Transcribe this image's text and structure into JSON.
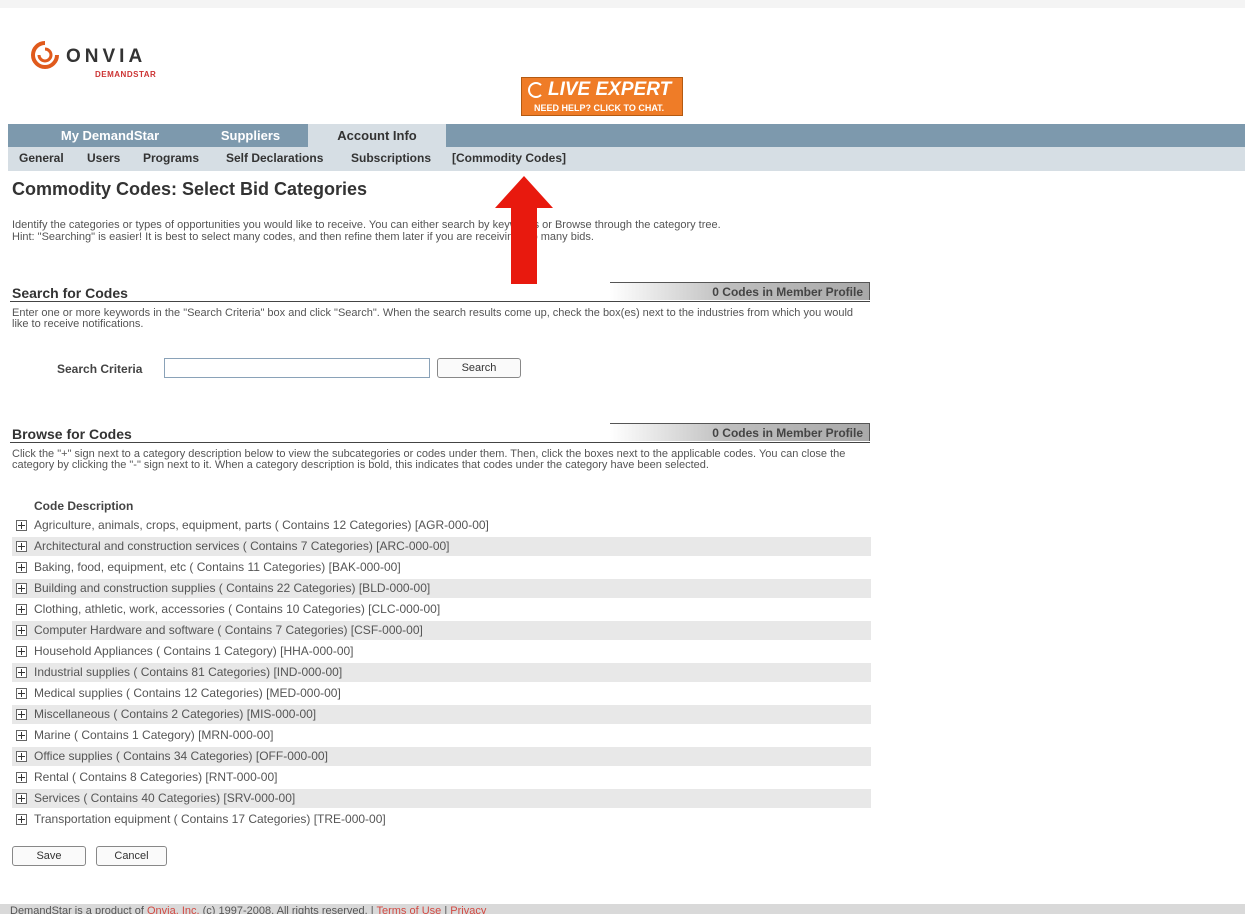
{
  "brand": {
    "name": "ONVIA",
    "sub": "DEMANDSTAR"
  },
  "live_expert": {
    "title": "LIVE EXPERT",
    "sub": "NEED HELP? CLICK TO CHAT."
  },
  "tabs": [
    {
      "label": "My DemandStar"
    },
    {
      "label": "Suppliers"
    },
    {
      "label": "Account Info",
      "active": true
    }
  ],
  "subnav": [
    {
      "label": "General"
    },
    {
      "label": "Users"
    },
    {
      "label": "Programs"
    },
    {
      "label": "Self Declarations"
    },
    {
      "label": "Subscriptions"
    },
    {
      "label": "[Commodity Codes]",
      "active": true
    }
  ],
  "page": {
    "title": "Commodity Codes: Select Bid Categories",
    "intro_line1": "Identify the categories or types of opportunities you would like to receive. You can either search by keywords or Browse through the category tree.",
    "intro_line2": "Hint: \"Searching\" is easier! It is best to select many codes, and then refine them later if you are receiving too many bids."
  },
  "search": {
    "title": "Search for Codes",
    "count": "0 Codes in Member Profile",
    "description": "Enter one or more keywords in the \"Search Criteria\" box and click \"Search\". When the search results come up, check the box(es) next to the industries from which you would like to receive notifications.",
    "criteria_label": "Search Criteria",
    "input_value": "",
    "button_label": "Search"
  },
  "browse": {
    "title": "Browse for Codes",
    "count": "0 Codes in Member Profile",
    "description": "Click the \"+\" sign next to a category description below to view the subcategories or codes under them. Then, click the boxes next to the applicable codes. You can close the category by clicking the \"-\" sign next to it. When a category description is bold, this indicates that codes under the category have been selected.",
    "column_header": "Code Description",
    "categories": [
      "Agriculture, animals, crops, equipment, parts ( Contains 12 Categories) [AGR-000-00]",
      "Architectural and construction services ( Contains 7 Categories) [ARC-000-00]",
      "Baking, food, equipment, etc ( Contains 11 Categories) [BAK-000-00]",
      "Building and construction supplies ( Contains 22 Categories) [BLD-000-00]",
      "Clothing, athletic, work, accessories ( Contains 10 Categories) [CLC-000-00]",
      "Computer Hardware and software ( Contains 7 Categories) [CSF-000-00]",
      "Household Appliances ( Contains 1 Category) [HHA-000-00]",
      "Industrial supplies ( Contains 81 Categories) [IND-000-00]",
      "Medical supplies ( Contains 12 Categories) [MED-000-00]",
      "Miscellaneous ( Contains 2 Categories) [MIS-000-00]",
      "Marine ( Contains 1 Category) [MRN-000-00]",
      "Office supplies ( Contains 34 Categories) [OFF-000-00]",
      "Rental ( Contains 8 Categories) [RNT-000-00]",
      "Services ( Contains 40 Categories) [SRV-000-00]",
      "Transportation equipment ( Contains 17 Categories) [TRE-000-00]"
    ]
  },
  "actions": {
    "save_label": "Save",
    "cancel_label": "Cancel"
  },
  "footer": {
    "text_before": "DemandStar is a product of",
    "company_link": "Onvia, Inc.",
    "copyright": "(c) 1997-2008. All rights reserved.",
    "separator": "|",
    "terms_link": "Terms of Use",
    "privacy_link": "Privacy"
  },
  "colors": {
    "tab_bar": "#7d99ad",
    "subnav_bg": "#d6dee4",
    "live_expert": "#ef7c27",
    "arrow": "#e8190e",
    "footer_link": "#d24a43"
  },
  "icons": {
    "expand": "plus-box-icon",
    "logo": "onvia-swirl-icon",
    "annotation": "red-up-arrow"
  }
}
